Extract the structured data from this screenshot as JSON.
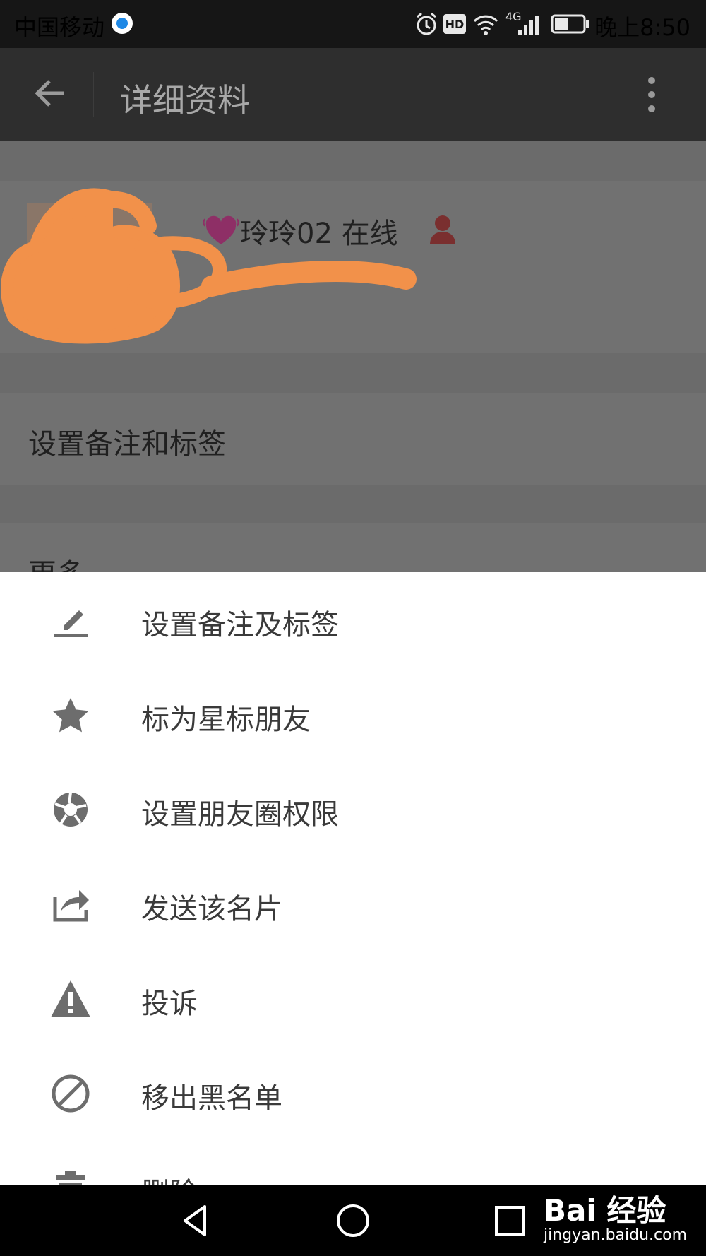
{
  "status_bar": {
    "carrier": "中国移动",
    "network": "4G",
    "hd_badge": "HD",
    "time": "晚上8:50"
  },
  "app_bar": {
    "title": "详细资料"
  },
  "profile": {
    "nickname": "玲玲02 在线",
    "remark_row_label": "设置备注和标签",
    "more_row_label": "更多"
  },
  "menu": {
    "items": [
      {
        "label": "设置备注及标签",
        "icon": "pencil-icon"
      },
      {
        "label": "标为星标朋友",
        "icon": "star-icon"
      },
      {
        "label": "设置朋友圈权限",
        "icon": "aperture-icon"
      },
      {
        "label": "发送该名片",
        "icon": "share-icon"
      },
      {
        "label": "投诉",
        "icon": "warning-icon"
      },
      {
        "label": "移出黑名单",
        "icon": "block-icon"
      },
      {
        "label": "删除",
        "icon": "trash-icon"
      }
    ]
  },
  "watermark": {
    "brand": "Bai 经验",
    "url": "jingyan.baidu.com"
  },
  "colors": {
    "status_bar_bg": "#161616",
    "app_bar_bg": "#2e2e2e",
    "dim_overlay": "#6b6b6b",
    "sheet_bg": "#ffffff",
    "icon_gray": "#6d6d6d",
    "scribble_orange": "#f2914a"
  }
}
